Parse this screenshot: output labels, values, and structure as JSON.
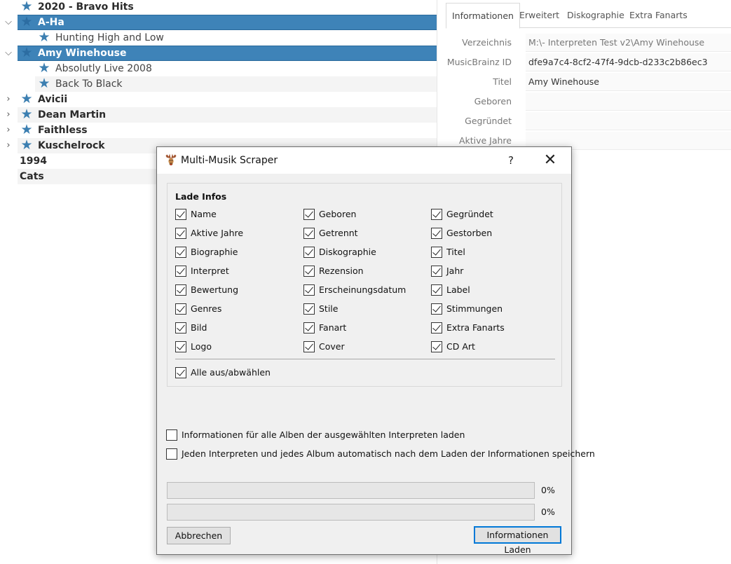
{
  "tree": {
    "rows": [
      {
        "label": "2020 - Bravo Hits",
        "arrow": "",
        "star": "★"
      },
      {
        "label": "A-Ha",
        "arrow": "⌵",
        "star": "★"
      },
      {
        "label": "Hunting High and Low",
        "arrow": "",
        "star": "★"
      },
      {
        "label": "Amy Winehouse",
        "arrow": "⌵",
        "star": "★"
      },
      {
        "label": "Absolutly Live 2008",
        "arrow": "",
        "star": "★"
      },
      {
        "label": "Back To Black",
        "arrow": "",
        "star": "★"
      },
      {
        "label": "Avicii",
        "arrow": "›",
        "star": "★"
      },
      {
        "label": "Dean Martin",
        "arrow": "›",
        "star": "★"
      },
      {
        "label": "Faithless",
        "arrow": "›",
        "star": "★"
      },
      {
        "label": "Kuschelrock",
        "arrow": "›",
        "star": "★"
      },
      {
        "label": "1994",
        "arrow": "",
        "star": ""
      },
      {
        "label": "Cats",
        "arrow": "",
        "star": ""
      }
    ]
  },
  "details": {
    "tabs": [
      "Informationen",
      "Erweitert",
      "Diskographie",
      "Extra Fanarts"
    ],
    "active_tab": "Informationen",
    "fields": [
      {
        "label": "Verzeichnis",
        "value": "M:\\- Interpreten Test v2\\Amy Winehouse"
      },
      {
        "label": "MusicBrainz ID",
        "value": "dfe9a7c4-8cf2-47f4-9dcb-d233c2b86ec3"
      },
      {
        "label": "Titel",
        "value": "Amy Winehouse"
      },
      {
        "label": "Geboren",
        "value": ""
      },
      {
        "label": "Gegründet",
        "value": ""
      },
      {
        "label": "Aktive Jahre",
        "value": ""
      }
    ]
  },
  "dialog": {
    "title": "Multi-Musik Scraper",
    "help_label": "?",
    "close_label": "✕",
    "group_title": "Lade Infos",
    "checkboxes": [
      [
        "Name",
        "Geboren",
        "Gegründet"
      ],
      [
        "Aktive Jahre",
        "Getrennt",
        "Gestorben"
      ],
      [
        "Biographie",
        "Diskographie",
        "Titel"
      ],
      [
        "Interpret",
        "Rezension",
        "Jahr"
      ],
      [
        "Bewertung",
        "Erscheinungsdatum",
        "Label"
      ],
      [
        "Genres",
        "Stile",
        "Stimmungen"
      ],
      [
        "Bild",
        "Fanart",
        "Extra Fanarts"
      ],
      [
        "Logo",
        "Cover",
        "CD Art"
      ]
    ],
    "select_all_label": "Alle aus/abwählen",
    "option_all_albums": "Informationen für alle Alben der ausgewählten Interpreten laden",
    "option_auto_save": "Jeden Interpreten und jedes Album automatisch nach dem Laden der Informationen speichern",
    "progress": [
      {
        "value": 0,
        "label": "0%"
      },
      {
        "value": 0,
        "label": "0%"
      }
    ],
    "cancel_label": "Abbrechen",
    "load_label": "Informationen Laden"
  }
}
